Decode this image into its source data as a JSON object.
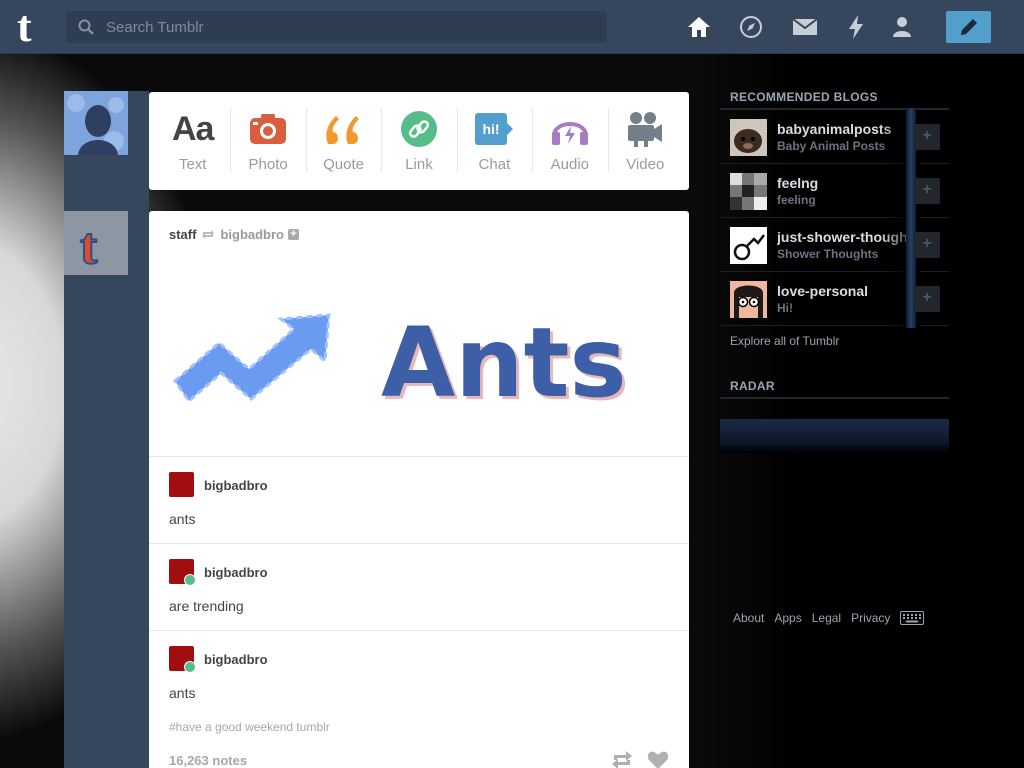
{
  "header": {
    "logo": "t",
    "search_placeholder": "Search Tumblr",
    "nav_icons": [
      "home-icon",
      "explore-icon",
      "inbox-icon",
      "activity-icon",
      "account-icon"
    ],
    "compose_icon": "pencil-icon"
  },
  "creator": {
    "types": [
      {
        "label": "Text",
        "icon": "text-icon",
        "color": "#444444"
      },
      {
        "label": "Photo",
        "icon": "camera-icon",
        "color": "#d95e40"
      },
      {
        "label": "Quote",
        "icon": "quote-icon",
        "color": "#f2992e"
      },
      {
        "label": "Link",
        "icon": "link-icon",
        "color": "#56bc8a"
      },
      {
        "label": "Chat",
        "icon": "chat-icon",
        "color": "#529ecc"
      },
      {
        "label": "Audio",
        "icon": "headphones-icon",
        "color": "#a77dc2"
      },
      {
        "label": "Video",
        "icon": "video-camera-icon",
        "color": "#748089"
      }
    ]
  },
  "post": {
    "author": "staff",
    "source": "bigbadbro",
    "image_text": "Ants",
    "reblogs": [
      {
        "name": "bigbadbro",
        "text": "ants",
        "reblog_badge": false
      },
      {
        "name": "bigbadbro",
        "text": "are trending",
        "reblog_badge": true
      },
      {
        "name": "bigbadbro",
        "text": "ants",
        "reblog_badge": true
      }
    ],
    "tags": "#have a good weekend tumblr",
    "notes": "16,263 notes"
  },
  "sidebar": {
    "recommended_heading": "RECOMMENDED BLOGS",
    "blogs": [
      {
        "name": "babyanimalposts",
        "title": "Baby Animal Posts"
      },
      {
        "name": "feelng",
        "title": "feeling"
      },
      {
        "name": "just-shower-thoughts",
        "title": "Shower Thoughts"
      },
      {
        "name": "love-personal",
        "title": "Hi!"
      }
    ],
    "follow_label": "+",
    "explore_link": "Explore all of Tumblr",
    "radar_heading": "RADAR"
  },
  "footer": {
    "links": [
      "About",
      "Apps",
      "Legal",
      "Privacy"
    ],
    "keyboard_icon": "keyboard-icon"
  },
  "colors": {
    "header_bg": "#36465d",
    "compose_bg": "#529ecc",
    "body_bg": "#000000"
  }
}
